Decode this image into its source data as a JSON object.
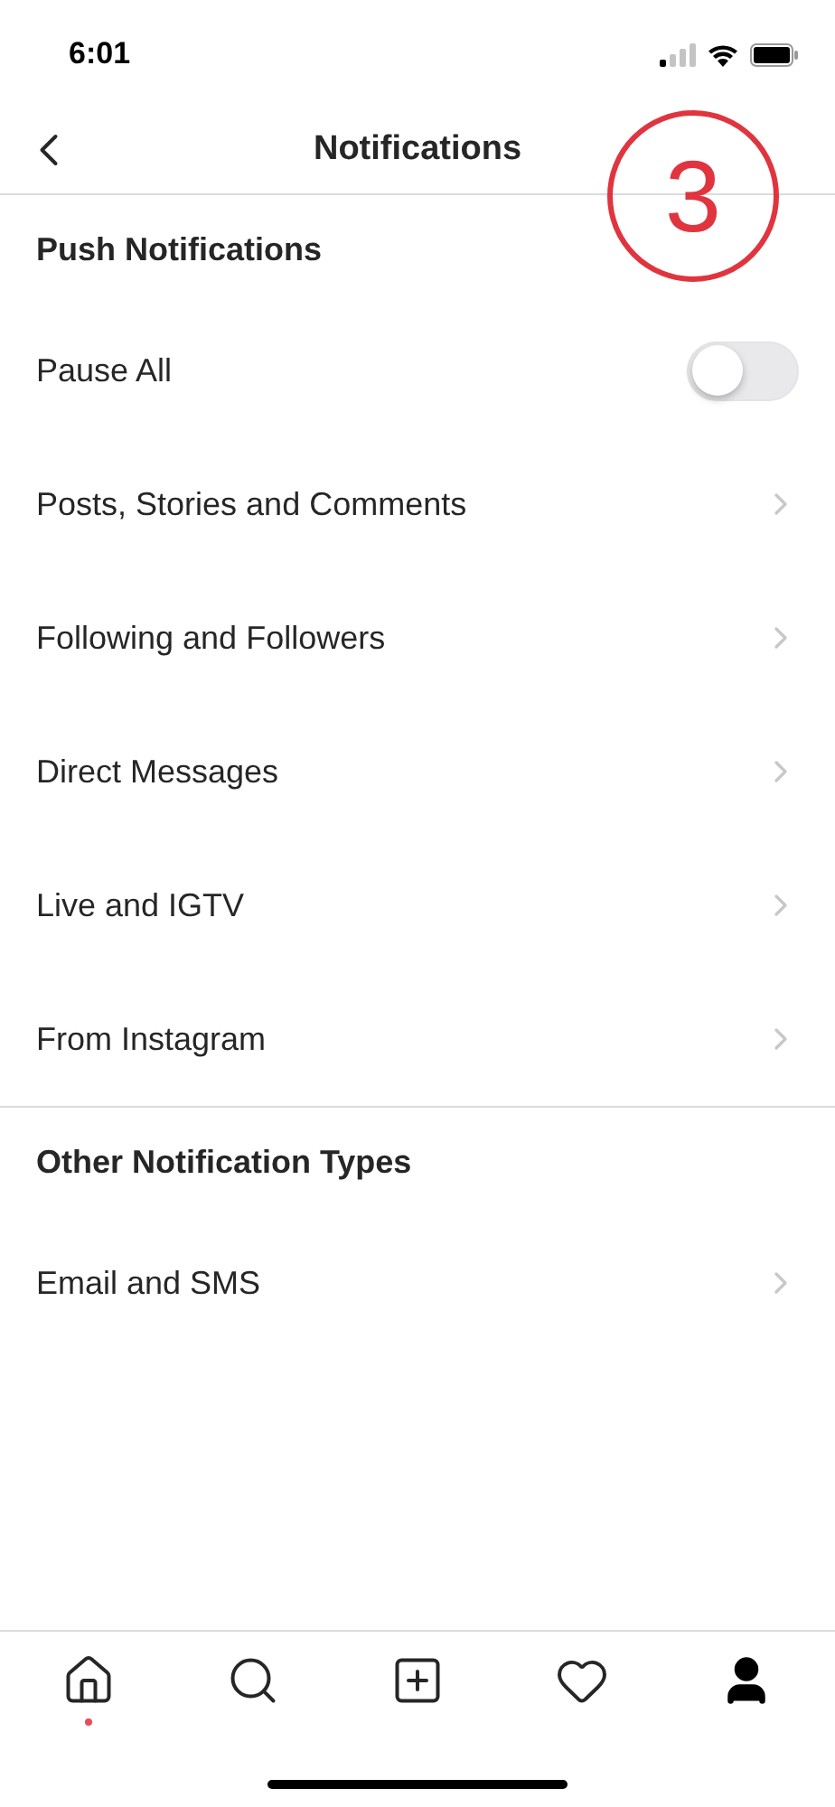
{
  "status_bar": {
    "time": "6:01"
  },
  "header": {
    "title": "Notifications"
  },
  "annotation": {
    "label": "3"
  },
  "sections": [
    {
      "title": "Push Notifications",
      "items": [
        {
          "kind": "toggle",
          "label": "Pause All",
          "on": false
        },
        {
          "kind": "link",
          "label": "Posts, Stories and Comments"
        },
        {
          "kind": "link",
          "label": "Following and Followers"
        },
        {
          "kind": "link",
          "label": "Direct Messages"
        },
        {
          "kind": "link",
          "label": "Live and IGTV"
        },
        {
          "kind": "link",
          "label": "From Instagram"
        }
      ]
    },
    {
      "title": "Other Notification Types",
      "items": [
        {
          "kind": "link",
          "label": "Email and SMS"
        }
      ]
    }
  ],
  "tab_bar": {
    "items": [
      {
        "selected": false,
        "dot": true
      },
      {
        "selected": false,
        "dot": false
      },
      {
        "selected": false,
        "dot": false
      },
      {
        "selected": false,
        "dot": false
      },
      {
        "selected": true,
        "dot": false
      }
    ]
  }
}
